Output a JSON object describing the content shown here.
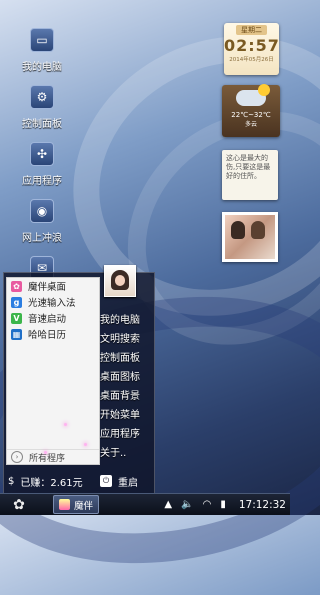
{
  "desktop_icons": [
    {
      "label": "我的电脑",
      "icon": "computer-icon"
    },
    {
      "label": "控制面板",
      "icon": "control-panel-icon"
    },
    {
      "label": "应用程序",
      "icon": "apps-icon"
    },
    {
      "label": "网上冲浪",
      "icon": "browser-icon"
    }
  ],
  "clock_widget": {
    "weekday": "星期二",
    "time": "02:57",
    "date": "2014年05月26日"
  },
  "weather_widget": {
    "temp": "22℃~32℃",
    "condition": "多云"
  },
  "note_widget": {
    "text": "这心是最大的伤,只要这是最好的住所。"
  },
  "start_menu": {
    "apps": [
      {
        "label": "魔伴桌面",
        "icon": "mobanzhuomian-icon",
        "color": "#e85aa0"
      },
      {
        "label": "光速输入法",
        "icon": "input-method-icon",
        "color": "#2a7de1"
      },
      {
        "label": "音速启动",
        "icon": "launcher-icon",
        "color": "#3bb54a"
      },
      {
        "label": "哈哈日历",
        "icon": "calendar-icon",
        "color": "#1f6fc8"
      }
    ],
    "all_programs": "所有程序",
    "right_items": [
      "我的电脑",
      "文明搜索",
      "控制面板",
      "桌面图标",
      "桌面背景",
      "开始菜单",
      "应用程序",
      "关于.."
    ],
    "money": "已赚：2.61元",
    "restart": "重启"
  },
  "taskbar": {
    "app_label": "魔伴",
    "time": "17:12:32"
  }
}
